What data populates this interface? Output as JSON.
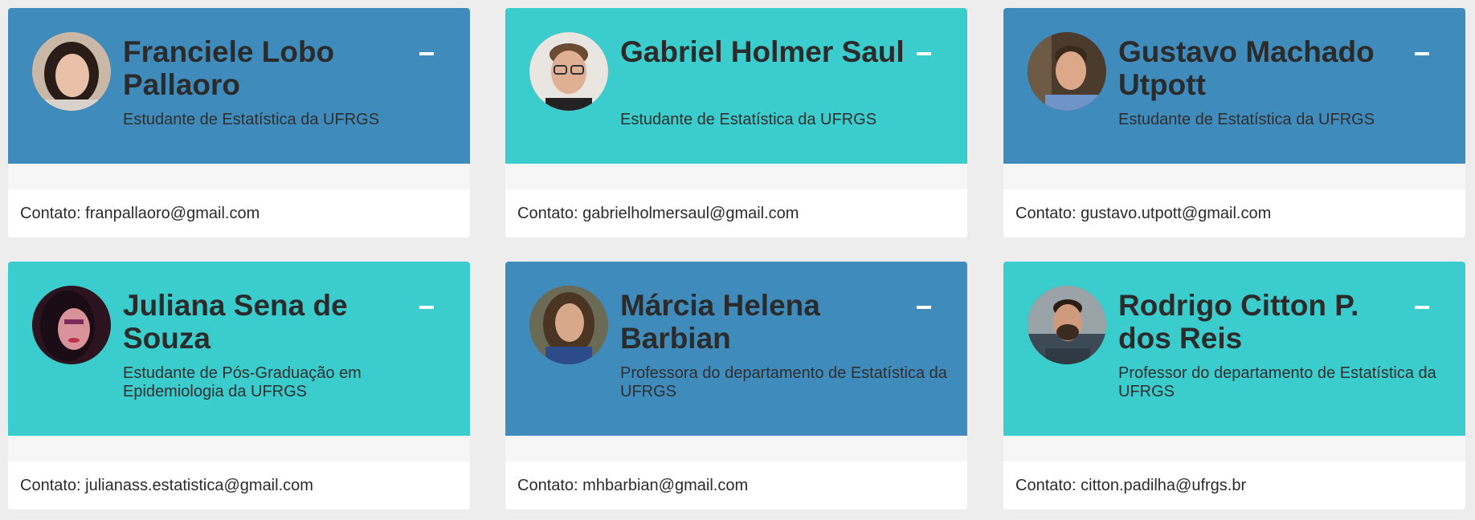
{
  "contact_prefix": "Contato:",
  "colors": {
    "blue": "#3e8bbc",
    "cyan": "#3bcccd"
  },
  "cards": [
    {
      "name": "Franciele Lobo Pallaoro",
      "role": "Estudante de Estatística da UFRGS",
      "email": "franpallaoro@gmail.com",
      "color": "blue"
    },
    {
      "name": "Gabriel Holmer Saul",
      "role": "Estudante de Estatística da UFRGS",
      "email": "gabrielholmersaul@gmail.com",
      "color": "cyan"
    },
    {
      "name": "Gustavo Machado Utpott",
      "role": "Estudante de Estatística da UFRGS",
      "email": "gustavo.utpott@gmail.com",
      "color": "blue"
    },
    {
      "name": "Juliana Sena de Souza",
      "role": "Estudante de Pós-Graduação em Epidemiologia da UFRGS",
      "email": "julianass.estatistica@gmail.com",
      "color": "cyan"
    },
    {
      "name": "Márcia Helena Barbian",
      "role": "Professora do departamento de Estatística da UFRGS",
      "email": "mhbarbian@gmail.com",
      "color": "blue"
    },
    {
      "name": "Rodrigo Citton P. dos Reis",
      "role": "Professor do departamento de Estatística da UFRGS",
      "email": "citton.padilha@ufrgs.br",
      "color": "cyan"
    }
  ]
}
